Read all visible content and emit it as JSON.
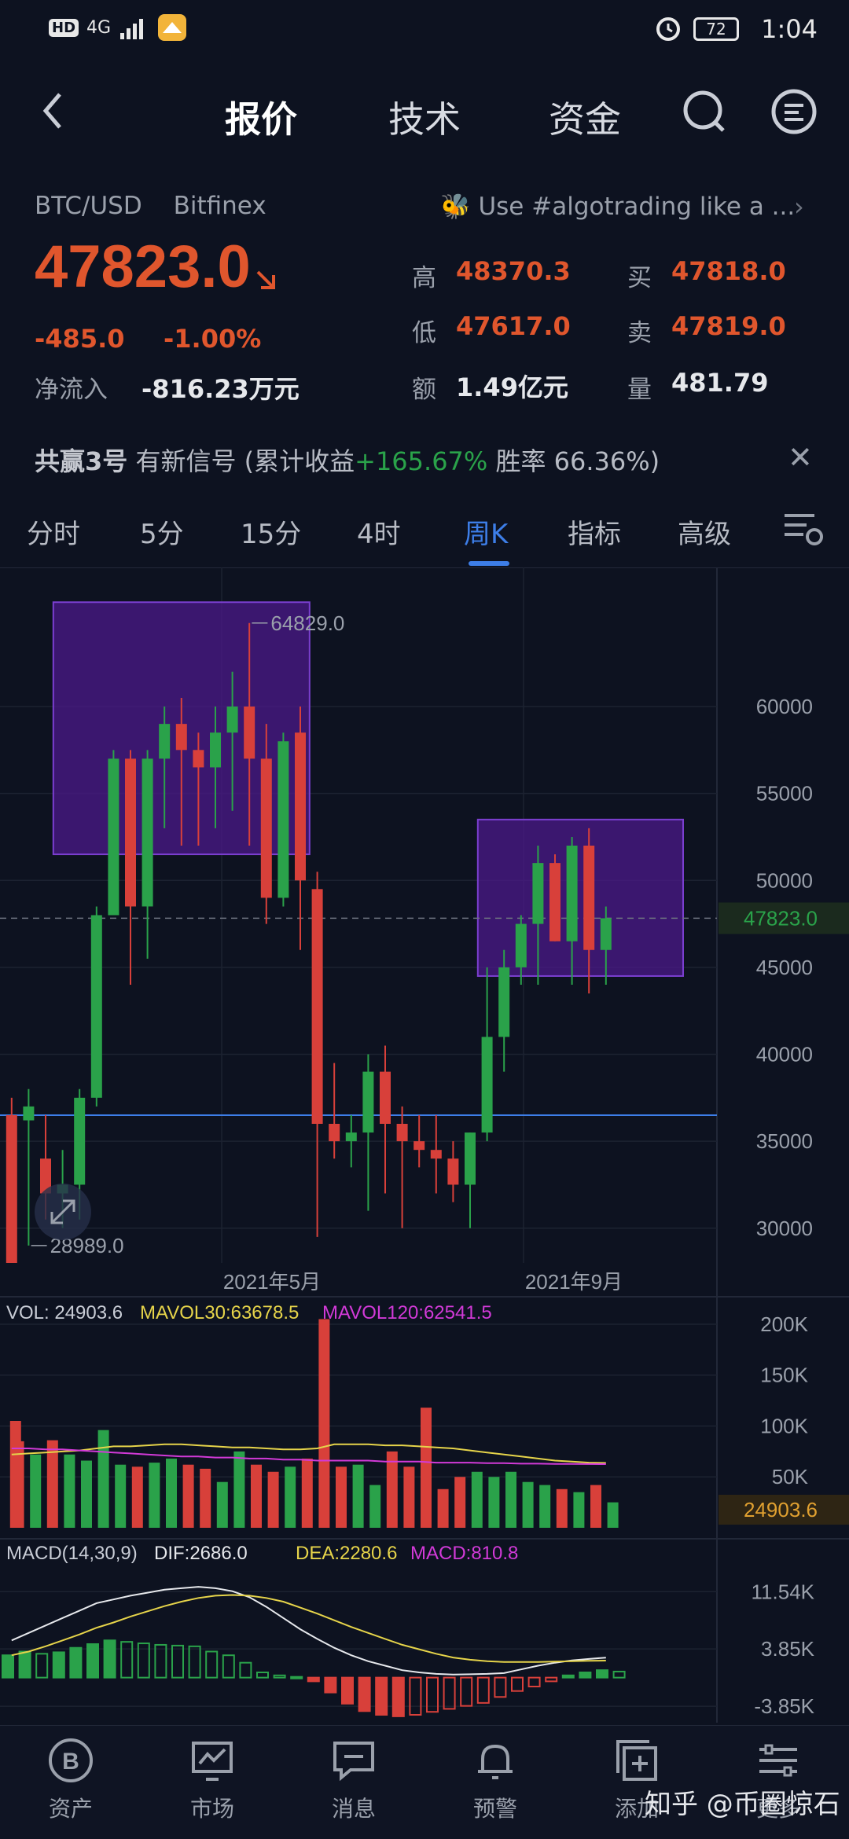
{
  "status": {
    "time": "1:04",
    "hd": "HD",
    "network": "4G",
    "battery": "72"
  },
  "tabs": [
    "报价",
    "技术",
    "资金"
  ],
  "ticker": {
    "pair": "BTC/USD",
    "exchange": "Bitfinex",
    "ad": "Use #algotrading like a ...",
    "price": "47823.0",
    "change": "-485.0",
    "change_pct": "-1.00%",
    "netflow_label": "净流入",
    "netflow": "-816.23万元",
    "high_label": "高",
    "high": "48370.3",
    "low_label": "低",
    "low": "47617.0",
    "amount_label": "额",
    "amount": "1.49亿元",
    "buy_label": "买",
    "buy": "47818.0",
    "sell_label": "卖",
    "sell": "47819.0",
    "volume_label": "量",
    "volume": "481.79"
  },
  "signal": {
    "name": "共赢3号",
    "text1": "有新信号 (累计收益",
    "gain": "+165.67%",
    "text2": "胜率 66.36%)"
  },
  "periods": [
    "分时",
    "5分",
    "15分",
    "4时",
    "周K",
    "指标",
    "高级"
  ],
  "chart_data": [
    {
      "type": "candlestick",
      "y_ticks": [
        "60000",
        "55000",
        "50000",
        "45000",
        "40000",
        "35000",
        "30000"
      ],
      "x_ticks": [
        "2021年5月",
        "2021年9月"
      ],
      "current_price_label": "47823.0",
      "max_label": "64829.0",
      "min_label": "28989.0",
      "ylim": [
        28000,
        68000
      ],
      "candles": [
        [
          36500,
          37500,
          36000,
          28000
        ],
        [
          36200,
          38000,
          29000,
          37000
        ],
        [
          34000,
          36500,
          30500,
          32000
        ],
        [
          32000,
          34500,
          30000,
          32500
        ],
        [
          32500,
          38000,
          30500,
          37500
        ],
        [
          37500,
          48500,
          37000,
          48000
        ],
        [
          48000,
          57500,
          48500,
          57000
        ],
        [
          57000,
          57500,
          44000,
          48500
        ],
        [
          48500,
          57500,
          45500,
          57000
        ],
        [
          57000,
          60000,
          53000,
          59000
        ],
        [
          59000,
          60500,
          52000,
          57500
        ],
        [
          57500,
          58500,
          52000,
          56500
        ],
        [
          56500,
          60000,
          53000,
          58500
        ],
        [
          58500,
          62000,
          54000,
          60000
        ],
        [
          60000,
          64800,
          52000,
          57000
        ],
        [
          57000,
          59000,
          47500,
          49000
        ],
        [
          49000,
          58500,
          48500,
          58000
        ],
        [
          58500,
          60000,
          46000,
          50000
        ],
        [
          49500,
          50500,
          29500,
          36000
        ],
        [
          36000,
          39500,
          34000,
          35000
        ],
        [
          35000,
          36500,
          33500,
          35500
        ],
        [
          35500,
          40000,
          31000,
          39000
        ],
        [
          39000,
          40500,
          32000,
          36000
        ],
        [
          36000,
          37000,
          30000,
          35000
        ],
        [
          35000,
          36500,
          33500,
          34500
        ],
        [
          34500,
          36500,
          32000,
          34000
        ],
        [
          34000,
          35000,
          31500,
          32500
        ],
        [
          32500,
          35500,
          30000,
          35500
        ],
        [
          35500,
          45000,
          35000,
          41000
        ],
        [
          41000,
          46000,
          39000,
          45000
        ],
        [
          45000,
          48000,
          44000,
          47500
        ],
        [
          47500,
          52000,
          44000,
          51000
        ],
        [
          51000,
          51500,
          46500,
          46500
        ],
        [
          46500,
          52500,
          44000,
          52000
        ],
        [
          52000,
          53000,
          43500,
          46000
        ],
        [
          46000,
          48500,
          44000,
          47823
        ]
      ],
      "highlight_boxes": [
        {
          "from": 3,
          "to": 18,
          "y_top": 66000,
          "y_bot": 51500
        },
        {
          "from": 28,
          "to": 40,
          "y_top": 53500,
          "y_bot": 44500
        }
      ],
      "hline": 36500
    },
    {
      "type": "bar",
      "title": "VOL",
      "vol_label": "VOL: 24903.6",
      "mavol30_label": "MAVOL30:63678.5",
      "mavol120_label": "MAVOL120:62541.5",
      "y_ticks": [
        "200K",
        "150K",
        "100K",
        "50K"
      ],
      "current_label": "24903.6",
      "ylim": [
        0,
        210000
      ],
      "values": [
        105000,
        85000,
        72000,
        86000,
        72000,
        66000,
        96000,
        62000,
        60000,
        64000,
        68000,
        62000,
        58000,
        45000,
        75000,
        62000,
        55000,
        60000,
        68000,
        205000,
        60000,
        62000,
        42000,
        75000,
        60000,
        118000,
        38000,
        50000,
        55000,
        50000,
        55000,
        45000,
        42000,
        38000,
        35000,
        42000,
        25000
      ],
      "mavol30": [
        72000,
        73000,
        74000,
        75000,
        76000,
        78000,
        80000,
        80000,
        81000,
        82000,
        82000,
        81000,
        80000,
        79000,
        79000,
        78000,
        77000,
        77000,
        78000,
        82000,
        82000,
        82000,
        81000,
        81000,
        80000,
        79000,
        78000,
        76000,
        74000,
        72000,
        70000,
        68000,
        66000,
        65000,
        64000,
        63700
      ],
      "mavol120": [
        78000,
        78000,
        77000,
        77000,
        76000,
        75000,
        74000,
        73000,
        72000,
        71000,
        70000,
        70000,
        69000,
        69000,
        68000,
        68000,
        67000,
        67000,
        66000,
        66000,
        66000,
        66000,
        65000,
        65000,
        65000,
        64000,
        64000,
        64000,
        63500,
        63500,
        63000,
        63000,
        62800,
        62700,
        62600,
        62541
      ]
    },
    {
      "type": "line",
      "title": "MACD(14,30,9)",
      "dif_label": "DIF:2686.0",
      "dea_label": "DEA:2280.6",
      "macd_label": "MACD:810.8",
      "y_ticks": [
        "11.54K",
        "3.85K",
        "-3.85K"
      ],
      "ylim": [
        -5000,
        14000
      ],
      "hist": [
        3000,
        3500,
        3200,
        3400,
        4000,
        4500,
        5000,
        4800,
        4600,
        4400,
        4300,
        4200,
        3500,
        3000,
        2000,
        700,
        300,
        100,
        -500,
        -2000,
        -3500,
        -4500,
        -5000,
        -5200,
        -5000,
        -4600,
        -4200,
        -3800,
        -3400,
        -2600,
        -1800,
        -1200,
        -500,
        300,
        700,
        1000,
        810
      ],
      "dif": [
        5000,
        6000,
        7000,
        8000,
        9000,
        10000,
        10500,
        11000,
        11400,
        11800,
        12000,
        12200,
        12000,
        11600,
        10800,
        9500,
        8000,
        6500,
        5200,
        4000,
        3000,
        2200,
        1600,
        1000,
        700,
        500,
        400,
        450,
        500,
        600,
        1100,
        1600,
        2000,
        2300,
        2500,
        2686
      ],
      "dea": [
        3000,
        3500,
        4200,
        5000,
        5800,
        6700,
        7400,
        8200,
        8900,
        9600,
        10200,
        10700,
        11000,
        11100,
        11000,
        10700,
        10200,
        9400,
        8600,
        7700,
        6800,
        6000,
        5200,
        4400,
        3800,
        3200,
        2700,
        2400,
        2200,
        2100,
        2100,
        2100,
        2150,
        2200,
        2250,
        2280
      ]
    }
  ],
  "nav": [
    {
      "label": "资产",
      "icon": "bitcoin-icon"
    },
    {
      "label": "市场",
      "icon": "market-chart-icon"
    },
    {
      "label": "消息",
      "icon": "message-icon"
    },
    {
      "label": "预警",
      "icon": "bell-icon"
    },
    {
      "label": "添加",
      "icon": "add-icon"
    },
    {
      "label": "更多",
      "icon": "settings-sliders-icon"
    }
  ],
  "watermark": "知乎 @币圈惊石",
  "colors": {
    "up": "#2aa24a",
    "down": "#d8403a",
    "accent": "#3d7ee8",
    "purple_box": "#4b1a8a"
  }
}
